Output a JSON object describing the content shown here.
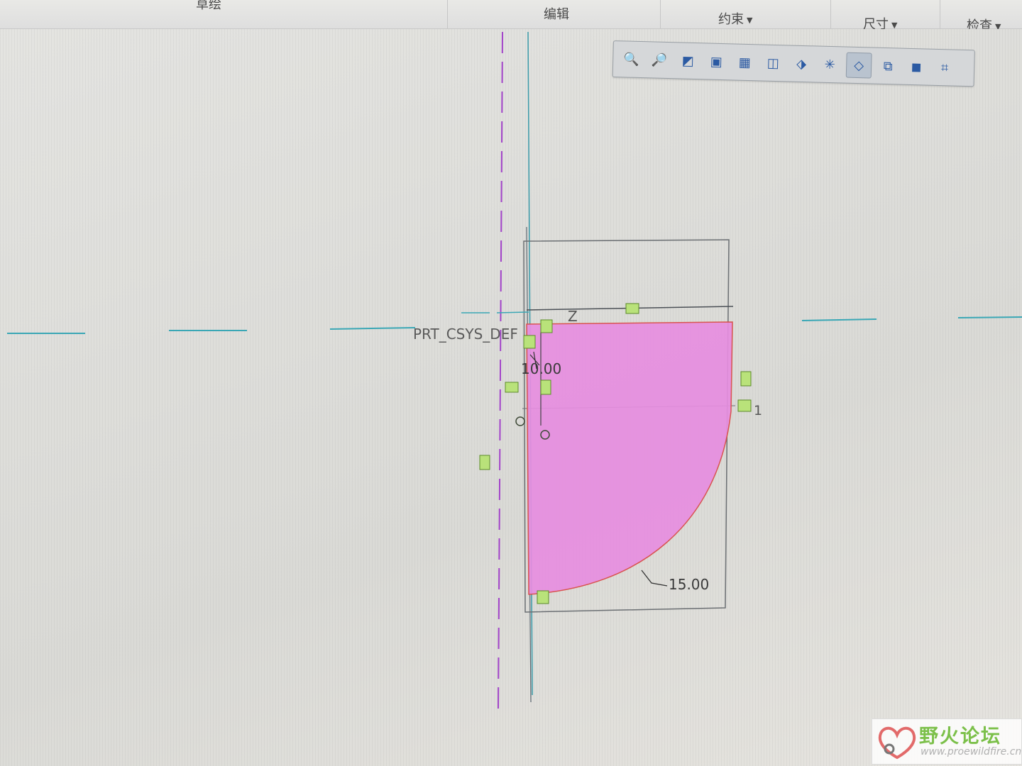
{
  "ribbon": {
    "tabs": [
      {
        "label": "草绘"
      },
      {
        "label": "编辑"
      },
      {
        "label": "约束"
      },
      {
        "label": "尺寸"
      },
      {
        "label": "检查"
      }
    ]
  },
  "graphics_toolbar": {
    "buttons": [
      {
        "icon": "zoom-in-icon"
      },
      {
        "icon": "zoom-out-icon"
      },
      {
        "icon": "refit-icon"
      },
      {
        "icon": "repaint-icon"
      },
      {
        "icon": "display-style-icon"
      },
      {
        "icon": "saved-views-icon"
      },
      {
        "icon": "sketch-view-icon"
      },
      {
        "icon": "datum-display-icon"
      },
      {
        "icon": "sketcher-display-icon"
      },
      {
        "icon": "orient-icon"
      },
      {
        "icon": "shaded-icon"
      },
      {
        "icon": "dimension-display-icon"
      }
    ]
  },
  "sketch": {
    "csys_label": "PRT_CSYS_DEF",
    "axis_label": "Z",
    "dim_radius_small": "10.00",
    "dim_radius_large": "15.00",
    "equal_mark": "1",
    "fill_color": "#e68de0",
    "outline_color": "#d9534f"
  },
  "watermark": {
    "name": "野火论坛",
    "url": "www.proewildfire.cn"
  }
}
